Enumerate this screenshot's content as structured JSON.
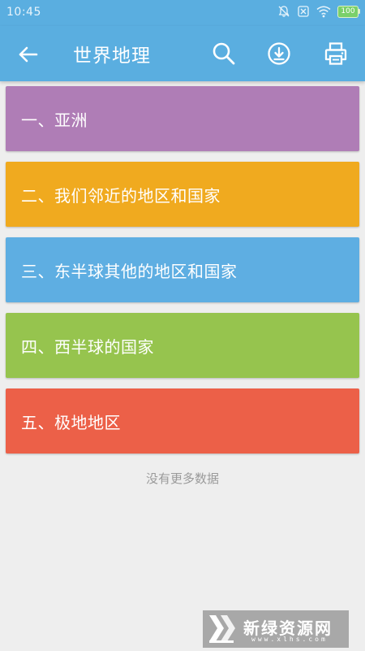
{
  "status_bar": {
    "time": "10:45",
    "icons": [
      "alarm-off-icon",
      "sim-off-icon",
      "wifi-icon",
      "battery-icon"
    ],
    "battery_level": "100"
  },
  "app_bar": {
    "title": "世界地理",
    "back_icon": "arrow-left-icon",
    "actions": [
      "search-icon",
      "download-icon",
      "print-icon"
    ],
    "background": "#5aaee0"
  },
  "chapters": [
    {
      "label": "一、亚洲",
      "color": "#af7db6"
    },
    {
      "label": "二、我们邻近的地区和国家",
      "color": "#f0aa1f"
    },
    {
      "label": "三、东半球其他的地区和国家",
      "color": "#5eaee2"
    },
    {
      "label": "四、西半球的国家",
      "color": "#96c44e"
    },
    {
      "label": "五、极地地区",
      "color": "#ec6048"
    }
  ],
  "list_footer": "没有更多数据",
  "watermark": {
    "brand": "新绿资源网",
    "domain": "www.xlhs.com"
  }
}
